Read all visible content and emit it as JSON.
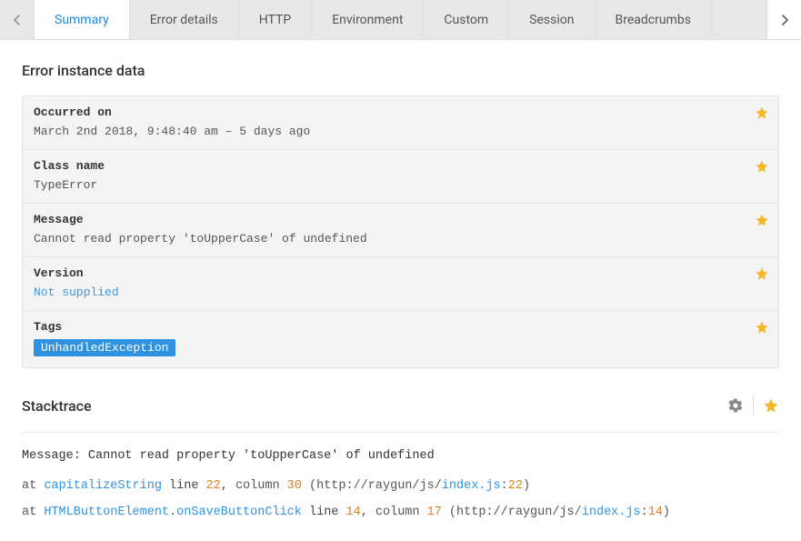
{
  "tabs": {
    "items": [
      "Summary",
      "Error details",
      "HTTP",
      "Environment",
      "Custom",
      "Session",
      "Breadcrumbs"
    ],
    "active_index": 0
  },
  "sections": {
    "instance_title": "Error instance data",
    "stacktrace_title": "Stacktrace"
  },
  "details": {
    "occurred_on": {
      "label": "Occurred on",
      "value": "March 2nd 2018, 9:48:40 am – 5 days ago"
    },
    "class_name": {
      "label": "Class name",
      "value": "TypeError"
    },
    "message": {
      "label": "Message",
      "value": "Cannot read property 'toUpperCase' of undefined"
    },
    "version": {
      "label": "Version",
      "value": "Not supplied",
      "is_link": true
    },
    "tags": {
      "label": "Tags",
      "pills": [
        "UnhandledException"
      ]
    }
  },
  "stacktrace": {
    "message_prefix": "Message: ",
    "message": "Cannot read property 'toUpperCase' of undefined",
    "frames": [
      {
        "at": "at ",
        "fn": "capitalizeString",
        "line_kw": " line ",
        "line": "22",
        "col_sep": ", column ",
        "col": "30",
        "open": " (",
        "url": "http://raygun/js/",
        "file": "index.js",
        "colon": ":",
        "file_line": "22",
        "close": ")"
      },
      {
        "at": "at ",
        "fn_pre": "HTMLButtonElement",
        "fn_dot": ".",
        "fn": "onSaveButtonClick",
        "line_kw": " line ",
        "line": "14",
        "col_sep": ", column ",
        "col": "17",
        "open": " (",
        "url": "http://raygun/js/",
        "file": "index.js",
        "colon": ":",
        "file_line": "14",
        "close": ")"
      }
    ]
  }
}
